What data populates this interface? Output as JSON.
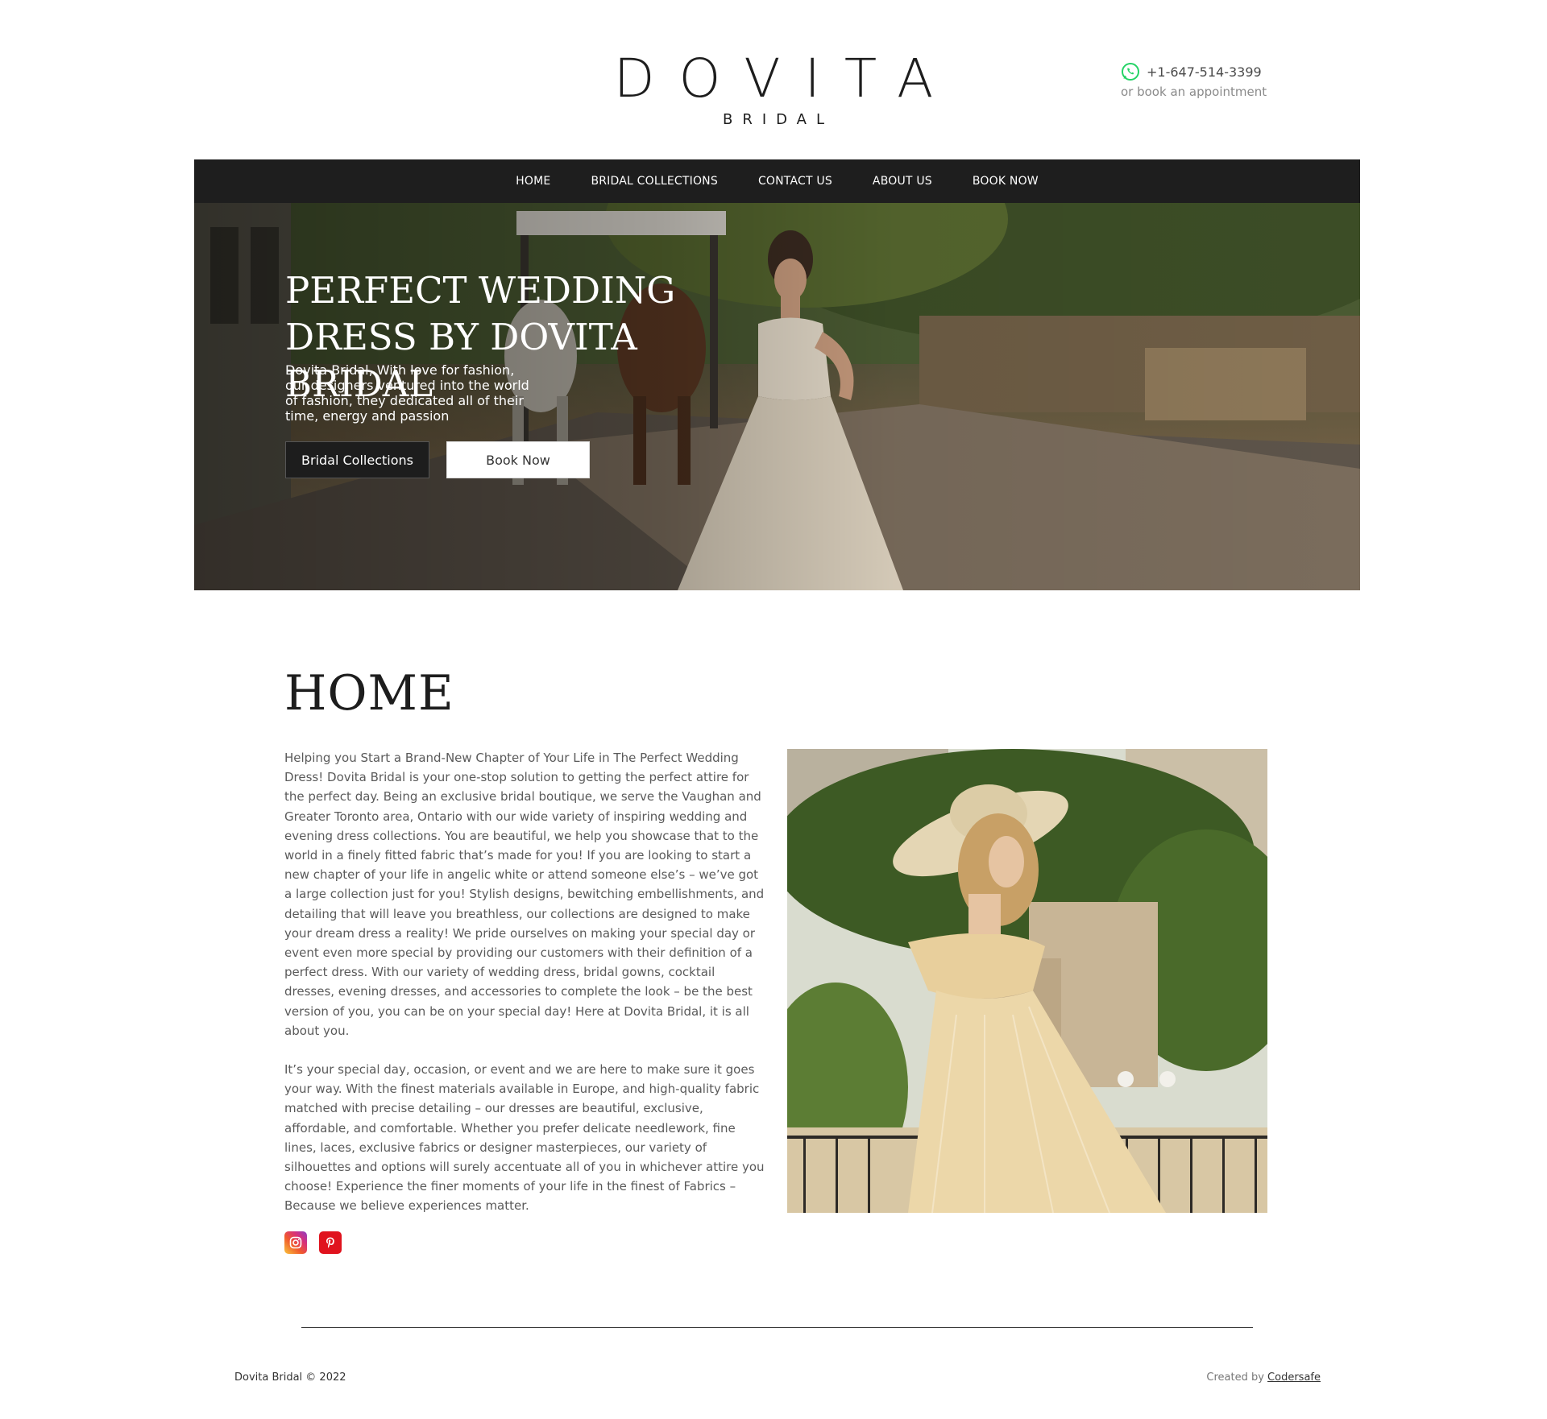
{
  "header": {
    "logo_main": "DOVITA",
    "logo_sub": "BRIDAL",
    "phone": "+1-647-514-3399",
    "appointment_text": "or book an appointment",
    "phone_icon": "whatsapp-icon"
  },
  "nav": {
    "items": [
      {
        "label": "HOME"
      },
      {
        "label": "BRIDAL COLLECTIONS"
      },
      {
        "label": "CONTACT US"
      },
      {
        "label": "ABOUT US"
      },
      {
        "label": "BOOK NOW"
      }
    ]
  },
  "hero": {
    "title_line1": "PERFECT WEDDING",
    "title_line2": "DRESS BY DOVITA BRIDAL",
    "description": "Dovita Bridal, With love for fashion, our designers ventured into the world of fashion, they dedicated all of their time, energy and passion",
    "primary_button": "Bridal Collections",
    "secondary_button": "Book Now"
  },
  "content": {
    "title": "HOME",
    "paragraph1": "Helping you Start a Brand-New Chapter of Your Life in The Perfect Wedding Dress! Dovita Bridal is your one-stop solution to getting the perfect attire for the perfect day. Being an exclusive bridal boutique, we serve the Vaughan and Greater Toronto area, Ontario with our wide variety of inspiring wedding and evening dress collections. You are beautiful, we help you showcase that to the world in a finely fitted fabric that’s made for you! If you are looking to start a new chapter of your life in angelic white or attend someone else’s – we’ve got a large collection just for you! Stylish designs, bewitching embellishments, and detailing that will leave you breathless, our collections are designed to make your dream dress a reality! We pride ourselves on making your special day or event even more special by providing our customers with their definition of a perfect dress. With our variety of wedding dress, bridal gowns, cocktail dresses, evening dresses, and accessories to complete the look – be the best version of you, you can be on your special day! Here at Dovita Bridal, it is all about you.",
    "paragraph2": "It’s your special day, occasion, or event and we are here to make sure it goes your way. With the finest materials available in Europe, and high-quality fabric matched with precise detailing – our dresses are beautiful, exclusive, affordable, and comfortable. Whether you prefer delicate needlework, fine lines, laces, exclusive fabrics or designer masterpieces, our variety of silhouettes and options will surely accentuate all of you in whichever attire you choose! Experience the finer moments of your life in the finest of Fabrics – Because we believe experiences matter.",
    "social": [
      {
        "icon": "instagram-icon",
        "color": "#d8307a"
      },
      {
        "icon": "pinterest-icon",
        "color": "#e0131e"
      }
    ]
  },
  "footer": {
    "copyright": "Dovita Bridal © 2022",
    "created_by": "Created by",
    "creator": "Codersafe"
  },
  "colors": {
    "nav_bg": "#1e1e1e",
    "accent_green": "#25d366",
    "text": "#333333"
  }
}
